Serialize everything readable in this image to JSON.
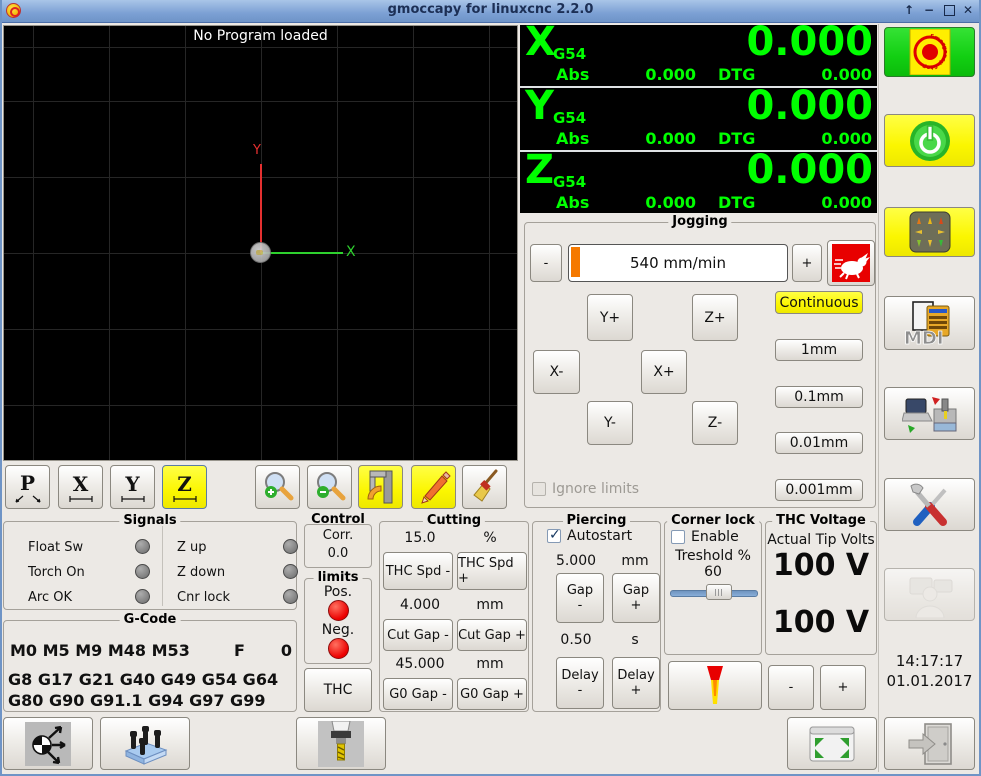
{
  "titlebar": {
    "title": "gmoccapy for linuxcnc  2.2.0",
    "shade": "↑",
    "minimize": "−",
    "close": "✕"
  },
  "preview": {
    "message": "No Program loaded",
    "x_axis_label": "X",
    "y_axis_label": "Y"
  },
  "view_toolbar": {
    "p": "P",
    "x": "X",
    "y": "Y",
    "z": "Z"
  },
  "dro": {
    "rows": [
      {
        "letter": "X",
        "system": "G54",
        "main": "0.000",
        "abs_label": "Abs",
        "abs": "0.000",
        "dtg_label": "DTG",
        "dtg": "0.000"
      },
      {
        "letter": "Y",
        "system": "G54",
        "main": "0.000",
        "abs_label": "Abs",
        "abs": "0.000",
        "dtg_label": "DTG",
        "dtg": "0.000"
      },
      {
        "letter": "Z",
        "system": "G54",
        "main": "0.000",
        "abs_label": "Abs",
        "abs": "0.000",
        "dtg_label": "DTG",
        "dtg": "0.000"
      }
    ]
  },
  "jogging": {
    "title": "Jogging",
    "minus": "-",
    "plus": "+",
    "speed": "540 mm/min",
    "y_plus": "Y+",
    "z_plus": "Z+",
    "x_minus": "X-",
    "x_plus": "X+",
    "y_minus": "Y-",
    "z_minus": "Z-",
    "increments": [
      "Continuous",
      "1mm",
      "0.1mm",
      "0.01mm",
      "0.001mm"
    ],
    "ignore_limits": "Ignore limits"
  },
  "signals": {
    "title": "Signals",
    "left": [
      "Float Sw",
      "Torch On",
      "Arc OK"
    ],
    "right": [
      "Z up",
      "Z down",
      "Cnr lock"
    ]
  },
  "gcode": {
    "title": "G-Code",
    "m_codes": "M0 M5 M9 M48 M53",
    "f_label": "F",
    "f_value": "0",
    "g_codes": "G8 G17 G21 G40 G49 G54 G64 G80 G90 G91.1 G94 G97 G99"
  },
  "control": {
    "title": "Control",
    "corr_label": "Corr.",
    "corr_value": "0.0",
    "limits_title": "limits",
    "pos": "Pos.",
    "neg": "Neg.",
    "thc": "THC"
  },
  "cutting": {
    "title": "Cutting",
    "rows": [
      {
        "value": "15.0",
        "unit": "%",
        "minus": "THC Spd -",
        "plus": "THC Spd +"
      },
      {
        "value": "4.000",
        "unit": "mm",
        "minus": "Cut Gap -",
        "plus": "Cut Gap +"
      },
      {
        "value": "45.000",
        "unit": "mm",
        "minus": "G0 Gap -",
        "plus": "G0 Gap +"
      }
    ]
  },
  "piercing": {
    "title": "Piercing",
    "autostart": "Autostart",
    "height_value": "5.000",
    "height_unit": "mm",
    "gap_label": "Gap",
    "delay_value": "0.50",
    "delay_unit": "s",
    "delay_label": "Delay",
    "minus": "-",
    "plus": "+"
  },
  "corner_lock": {
    "title": "Corner lock",
    "enable": "Enable",
    "threshold_label": "Treshold %",
    "threshold_value": "60"
  },
  "thc_voltage": {
    "title": "THC Voltage",
    "subtitle": "Actual Tip Volts",
    "value_top": "100 V",
    "value_bottom": "100 V",
    "minus": "-",
    "plus": "+"
  },
  "clock": {
    "time": "14:17:17",
    "date": "01.01.2017"
  },
  "icons": {
    "estop_text": "Emergency-Stop",
    "mdi_label": "MDI",
    "rabbit": "max-velocity-rabbit",
    "torch": "torch-flame",
    "power": "machine-on-power",
    "jogpad": "manual-jog-arrows",
    "tools": "settings-tools",
    "exit": "exit-door",
    "fullscreen": "fullscreen-arrows"
  },
  "colors": {
    "dro_green": "#00ff00",
    "active_yellow": "#fbf600",
    "estop_green": "#12cf12",
    "progress_orange": "#f57900",
    "led_red": "#ec0000",
    "led_gray": "#7c7c7c",
    "titlebar_blue": "#7ca0d4"
  }
}
